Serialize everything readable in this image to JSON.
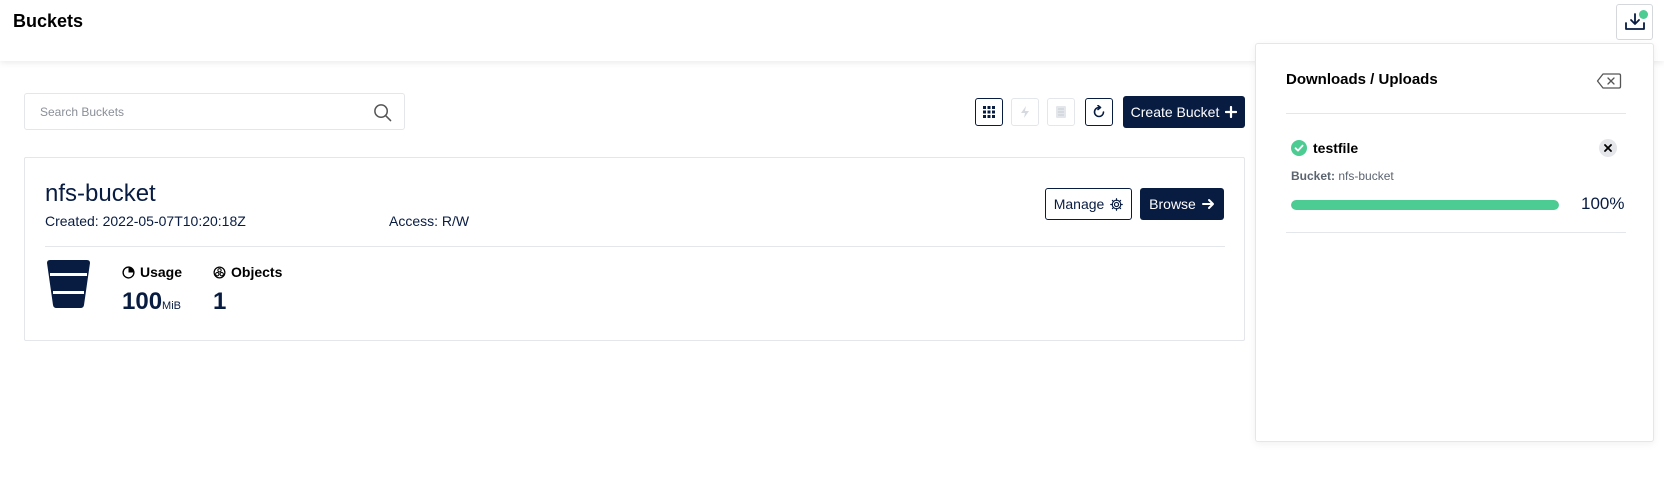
{
  "header": {
    "title": "Buckets"
  },
  "search": {
    "placeholder": "Search Buckets"
  },
  "toolbar": {
    "create_label": "Create Bucket"
  },
  "bucket": {
    "name": "nfs-bucket",
    "created": "Created: 2022-05-07T10:20:18Z",
    "access": "Access: R/W",
    "manage_label": "Manage",
    "browse_label": "Browse",
    "usage_label": "Usage",
    "usage_value": "100",
    "usage_unit": "MiB",
    "objects_label": "Objects",
    "objects_value": "1"
  },
  "panel": {
    "title": "Downloads / Uploads",
    "file_name": "testfile",
    "bucket_label": "Bucket:",
    "bucket_value": "nfs-bucket",
    "progress_percent": 100,
    "progress_text": "100%"
  },
  "colors": {
    "primary": "#081c42",
    "success": "#4ccb92",
    "border": "#e3e6ea"
  },
  "icons": [
    "download-icon",
    "search-icon",
    "grid-icon",
    "lightning-icon",
    "document-icon",
    "refresh-icon",
    "plus-icon",
    "gear-icon",
    "arrow-right-icon",
    "bucket-icon",
    "pie-chart-icon",
    "objects-icon",
    "clear-icon",
    "check-circle-icon",
    "close-icon"
  ]
}
